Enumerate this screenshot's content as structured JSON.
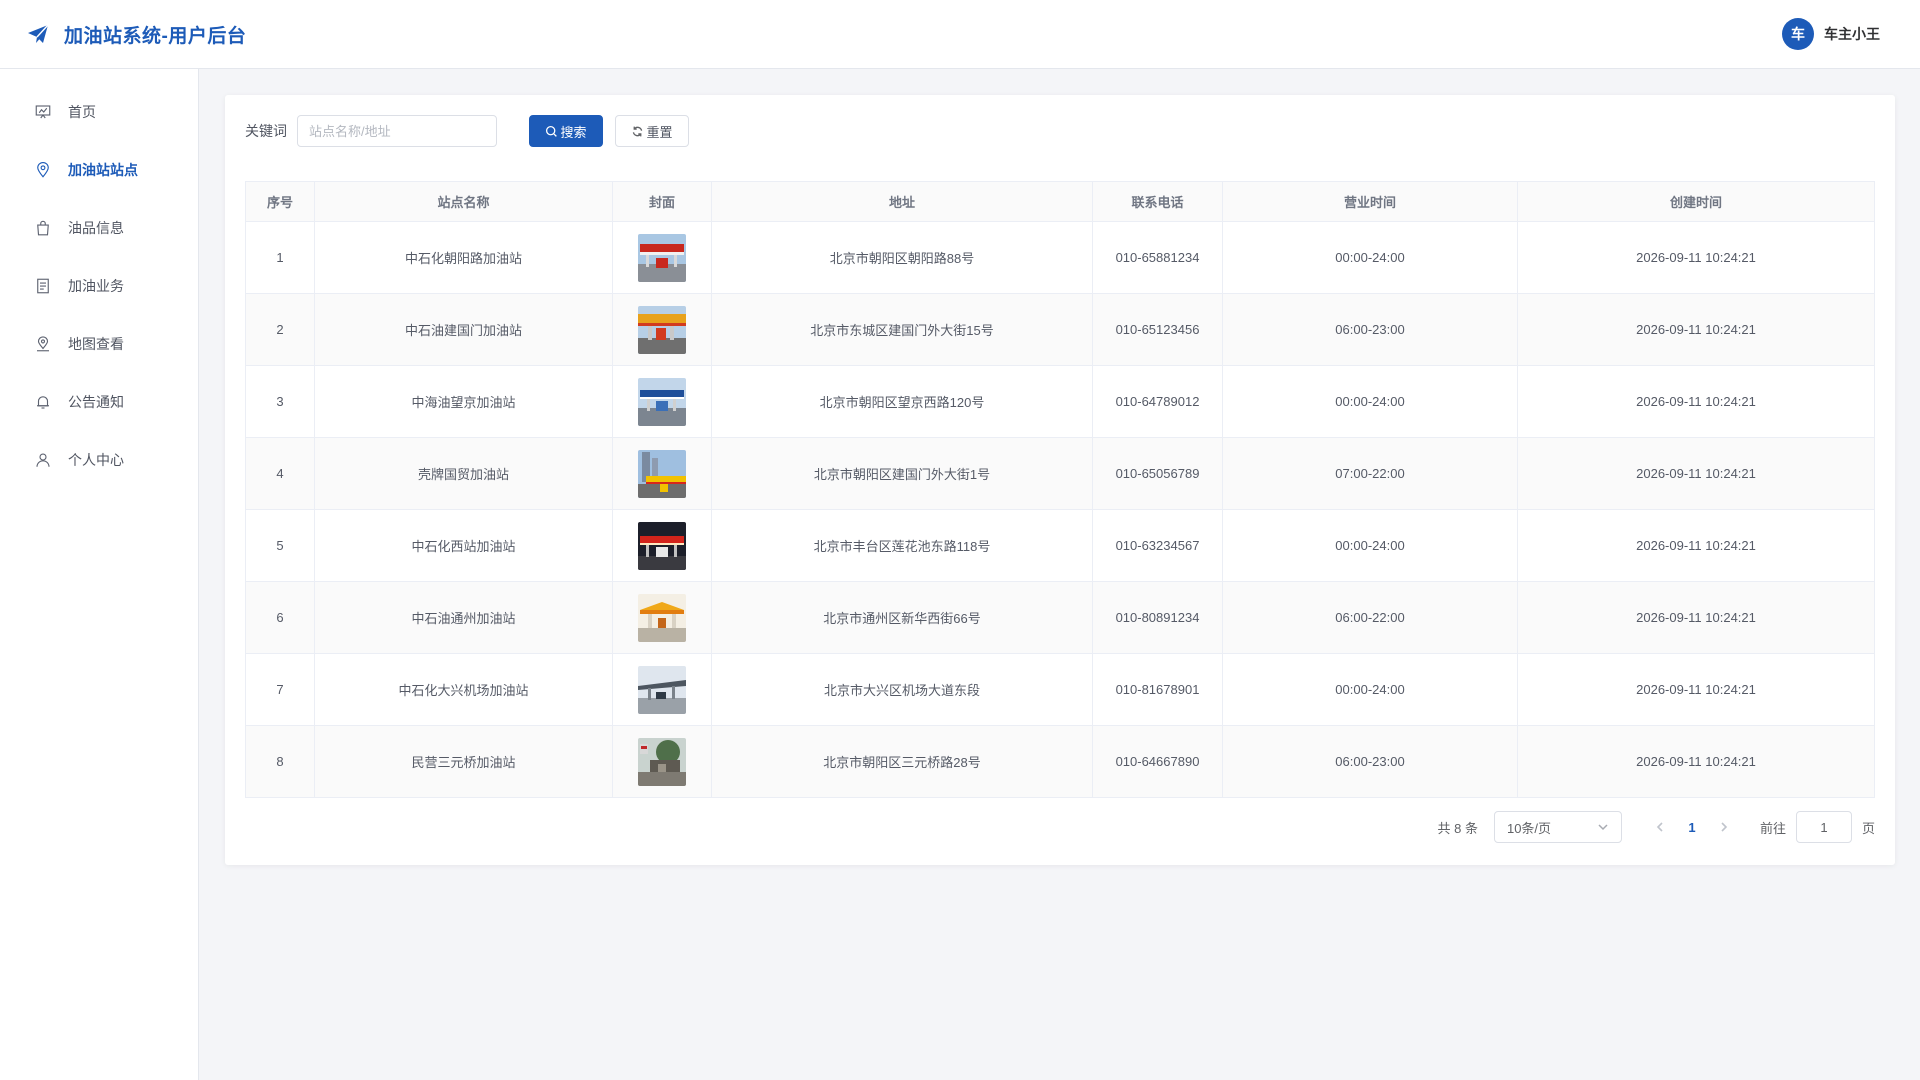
{
  "header": {
    "title": "加油站系统-用户后台",
    "avatar_text": "车",
    "user_name": "车主小王"
  },
  "sidebar": {
    "items": [
      {
        "label": "首页",
        "icon": "dashboard-icon"
      },
      {
        "label": "加油站站点",
        "icon": "location-pin-icon",
        "active": true
      },
      {
        "label": "油品信息",
        "icon": "shopping-bag-icon"
      },
      {
        "label": "加油业务",
        "icon": "document-icon"
      },
      {
        "label": "地图查看",
        "icon": "map-pin-icon"
      },
      {
        "label": "公告通知",
        "icon": "bell-icon"
      },
      {
        "label": "个人中心",
        "icon": "user-icon"
      }
    ]
  },
  "search": {
    "label": "关键词",
    "placeholder": "站点名称/地址",
    "value": "",
    "search_button": "搜索",
    "reset_button": "重置"
  },
  "table": {
    "columns": [
      "序号",
      "站点名称",
      "封面",
      "地址",
      "联系电话",
      "营业时间",
      "创建时间"
    ],
    "rows": [
      {
        "no": "1",
        "name": "中石化朝阳路加油站",
        "cover": "station-photo",
        "address": "北京市朝阳区朝阳路88号",
        "phone": "010-65881234",
        "hours": "00:00-24:00",
        "created": "2026-09-11 10:24:21"
      },
      {
        "no": "2",
        "name": "中石油建国门加油站",
        "cover": "station-photo",
        "address": "北京市东城区建国门外大街15号",
        "phone": "010-65123456",
        "hours": "06:00-23:00",
        "created": "2026-09-11 10:24:21"
      },
      {
        "no": "3",
        "name": "中海油望京加油站",
        "cover": "station-photo",
        "address": "北京市朝阳区望京西路120号",
        "phone": "010-64789012",
        "hours": "00:00-24:00",
        "created": "2026-09-11 10:24:21"
      },
      {
        "no": "4",
        "name": "壳牌国贸加油站",
        "cover": "station-photo",
        "address": "北京市朝阳区建国门外大街1号",
        "phone": "010-65056789",
        "hours": "07:00-22:00",
        "created": "2026-09-11 10:24:21"
      },
      {
        "no": "5",
        "name": "中石化西站加油站",
        "cover": "station-photo",
        "address": "北京市丰台区莲花池东路118号",
        "phone": "010-63234567",
        "hours": "00:00-24:00",
        "created": "2026-09-11 10:24:21"
      },
      {
        "no": "6",
        "name": "中石油通州加油站",
        "cover": "station-photo",
        "address": "北京市通州区新华西街66号",
        "phone": "010-80891234",
        "hours": "06:00-22:00",
        "created": "2026-09-11 10:24:21"
      },
      {
        "no": "7",
        "name": "中石化大兴机场加油站",
        "cover": "station-photo",
        "address": "北京市大兴区机场大道东段",
        "phone": "010-81678901",
        "hours": "00:00-24:00",
        "created": "2026-09-11 10:24:21"
      },
      {
        "no": "8",
        "name": "民营三元桥加油站",
        "cover": "station-photo",
        "address": "北京市朝阳区三元桥路28号",
        "phone": "010-64667890",
        "hours": "06:00-23:00",
        "created": "2026-09-11 10:24:21"
      }
    ]
  },
  "pagination": {
    "total_text": "共 8 条",
    "page_size": "10条/页",
    "current_page": "1",
    "goto_label": "前往",
    "goto_value": "1",
    "page_suffix": "页"
  },
  "colors": {
    "primary": "#1d5bb8",
    "background": "#f4f5f8"
  }
}
